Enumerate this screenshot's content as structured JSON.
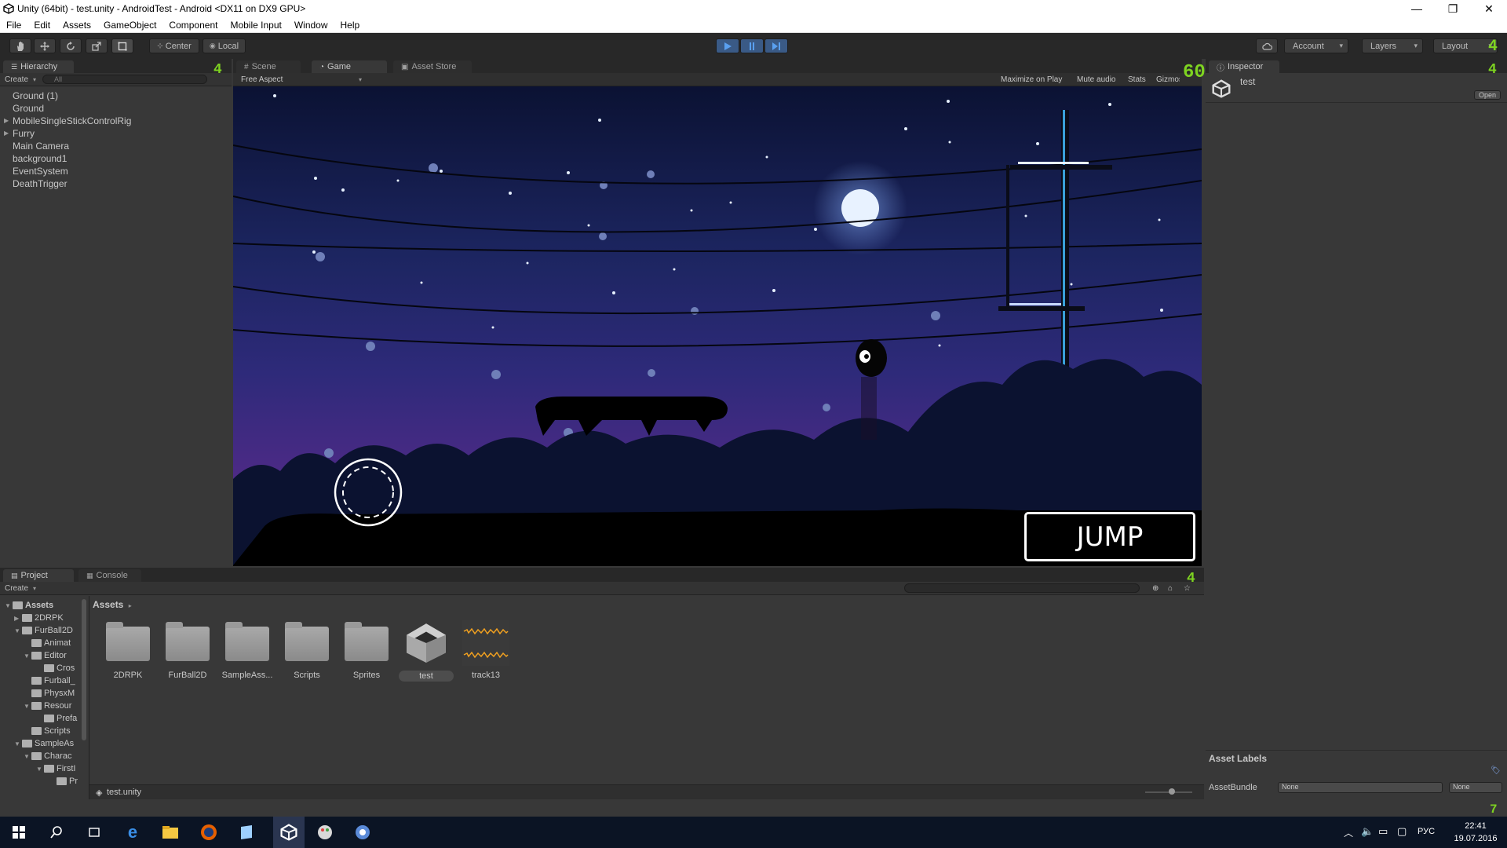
{
  "window": {
    "title": "Unity (64bit) - test.unity - AndroidTest - Android <DX11 on DX9 GPU>",
    "minimize": "—",
    "maximize": "❐",
    "close": "✕"
  },
  "menu": [
    "File",
    "Edit",
    "Assets",
    "GameObject",
    "Component",
    "Mobile Input",
    "Window",
    "Help"
  ],
  "toolbar": {
    "pivot": "Center",
    "space": "Local",
    "account": "Account",
    "layers": "Layers",
    "layout": "Layout"
  },
  "hierarchy": {
    "tab": "Hierarchy",
    "create": "Create",
    "search_placeholder": "All",
    "items": [
      "Ground (1)",
      "Ground",
      "MobileSingleStickControlRig",
      "Furry",
      "Main Camera",
      "background1",
      "EventSystem",
      "DeathTrigger"
    ]
  },
  "center_tabs": {
    "scene": "Scene",
    "game": "Game",
    "asset_store": "Asset Store"
  },
  "game": {
    "aspect": "Free Aspect",
    "maximize": "Maximize on Play",
    "mute": "Mute audio",
    "stats": "Stats",
    "gizmos": "Gizmos",
    "jump_button": "JUMP",
    "fps_overlay": "60"
  },
  "overlay_digits": {
    "hierarchy": "4",
    "project": "4",
    "inspector": "4",
    "layout": "4",
    "bottom": "7"
  },
  "project": {
    "tab": "Project",
    "console_tab": "Console",
    "create": "Create",
    "breadcrumb": "Assets",
    "tree": [
      {
        "label": "Assets",
        "depth": 0,
        "open": true,
        "bold": true
      },
      {
        "label": "2DRPK",
        "depth": 1,
        "open": false
      },
      {
        "label": "FurBall2D",
        "depth": 1,
        "open": true
      },
      {
        "label": "Animat",
        "depth": 2,
        "open": null
      },
      {
        "label": "Editor",
        "depth": 2,
        "open": true
      },
      {
        "label": "Cros",
        "depth": 3,
        "open": null
      },
      {
        "label": "Furball_",
        "depth": 2,
        "open": null
      },
      {
        "label": "PhysxM",
        "depth": 2,
        "open": null
      },
      {
        "label": "Resour",
        "depth": 2,
        "open": true
      },
      {
        "label": "Prefa",
        "depth": 3,
        "open": null
      },
      {
        "label": "Scripts",
        "depth": 2,
        "open": null
      },
      {
        "label": "SampleAs",
        "depth": 1,
        "open": true
      },
      {
        "label": "Charac",
        "depth": 2,
        "open": true
      },
      {
        "label": "FirstI",
        "depth": 3,
        "open": true
      },
      {
        "label": "Pr",
        "depth": 4,
        "open": null
      }
    ],
    "assets": [
      {
        "label": "2DRPK",
        "kind": "folder"
      },
      {
        "label": "FurBall2D",
        "kind": "folder"
      },
      {
        "label": "SampleAss...",
        "kind": "folder"
      },
      {
        "label": "Scripts",
        "kind": "folder"
      },
      {
        "label": "Sprites",
        "kind": "folder"
      },
      {
        "label": "test",
        "kind": "unity",
        "selected": true
      },
      {
        "label": "track13",
        "kind": "audio"
      }
    ],
    "footer_file": "test.unity"
  },
  "inspector": {
    "tab": "Inspector",
    "object_name": "test",
    "open_button": "Open",
    "asset_labels": "Asset Labels",
    "assetbundle_label": "AssetBundle",
    "bundle_value": "None",
    "variant_value": "None"
  },
  "taskbar": {
    "time": "22:41",
    "date": "19.07.2016",
    "lang": "РУС"
  }
}
